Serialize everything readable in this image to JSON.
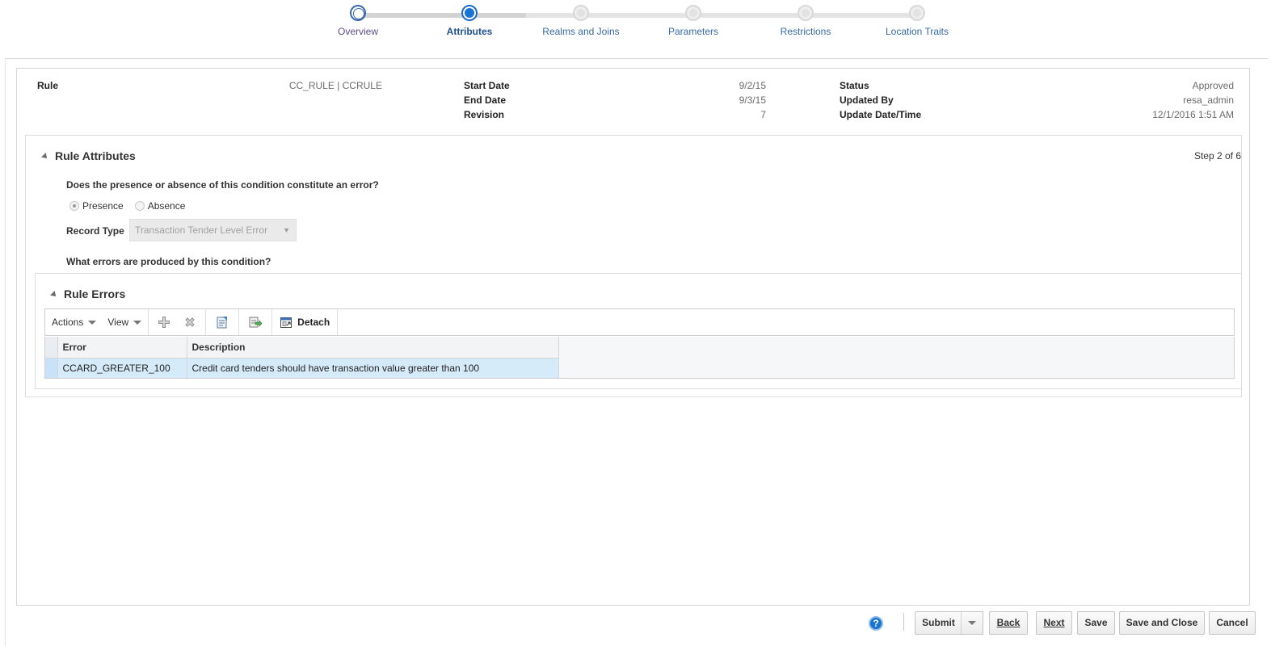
{
  "train": {
    "steps": [
      {
        "label": "Overview",
        "state": "visited"
      },
      {
        "label": "Attributes",
        "state": "current"
      },
      {
        "label": "Realms and Joins",
        "state": "unvisited"
      },
      {
        "label": "Parameters",
        "state": "unvisited"
      },
      {
        "label": "Restrictions",
        "state": "unvisited"
      },
      {
        "label": "Location Traits",
        "state": "unvisited"
      }
    ]
  },
  "header": {
    "rule_label": "Rule",
    "rule_value": "CC_RULE | CCRULE",
    "start_date_label": "Start Date",
    "start_date_value": "9/2/15",
    "end_date_label": "End Date",
    "end_date_value": "9/3/15",
    "revision_label": "Revision",
    "revision_value": "7",
    "status_label": "Status",
    "status_value": "Approved",
    "updated_by_label": "Updated By",
    "updated_by_value": "resa_admin",
    "update_datetime_label": "Update Date/Time",
    "update_datetime_value": "12/1/2016 1:51 AM"
  },
  "rule_attributes": {
    "title": "Rule Attributes",
    "step_text": "Step 2 of 6",
    "question1": "Does the presence or absence of this condition constitute an error?",
    "presence_label": "Presence",
    "absence_label": "Absence",
    "selected": "Presence",
    "record_type_label": "Record Type",
    "record_type_value": "Transaction Tender Level Error",
    "question2": "What errors are produced by this condition?"
  },
  "rule_errors": {
    "title": "Rule Errors",
    "toolbar": {
      "actions_label": "Actions",
      "view_label": "View",
      "detach_label": "Detach"
    },
    "columns": [
      "Error",
      "Description"
    ],
    "rows": [
      {
        "error": "CCARD_GREATER_100",
        "description": "Credit card tenders should have transaction value greater than 100"
      }
    ]
  },
  "footer": {
    "help_label": "?",
    "submit_label": "Submit",
    "back_label": "Back",
    "next_label": "Next",
    "save_label": "Save",
    "save_close_label": "Save and Close",
    "cancel_label": "Cancel"
  },
  "colors": {
    "accent": "#1a74d8",
    "selected_row": "#d6ebfa",
    "train_visited_text": "#5a4b8a",
    "train_text": "#376aa5"
  }
}
